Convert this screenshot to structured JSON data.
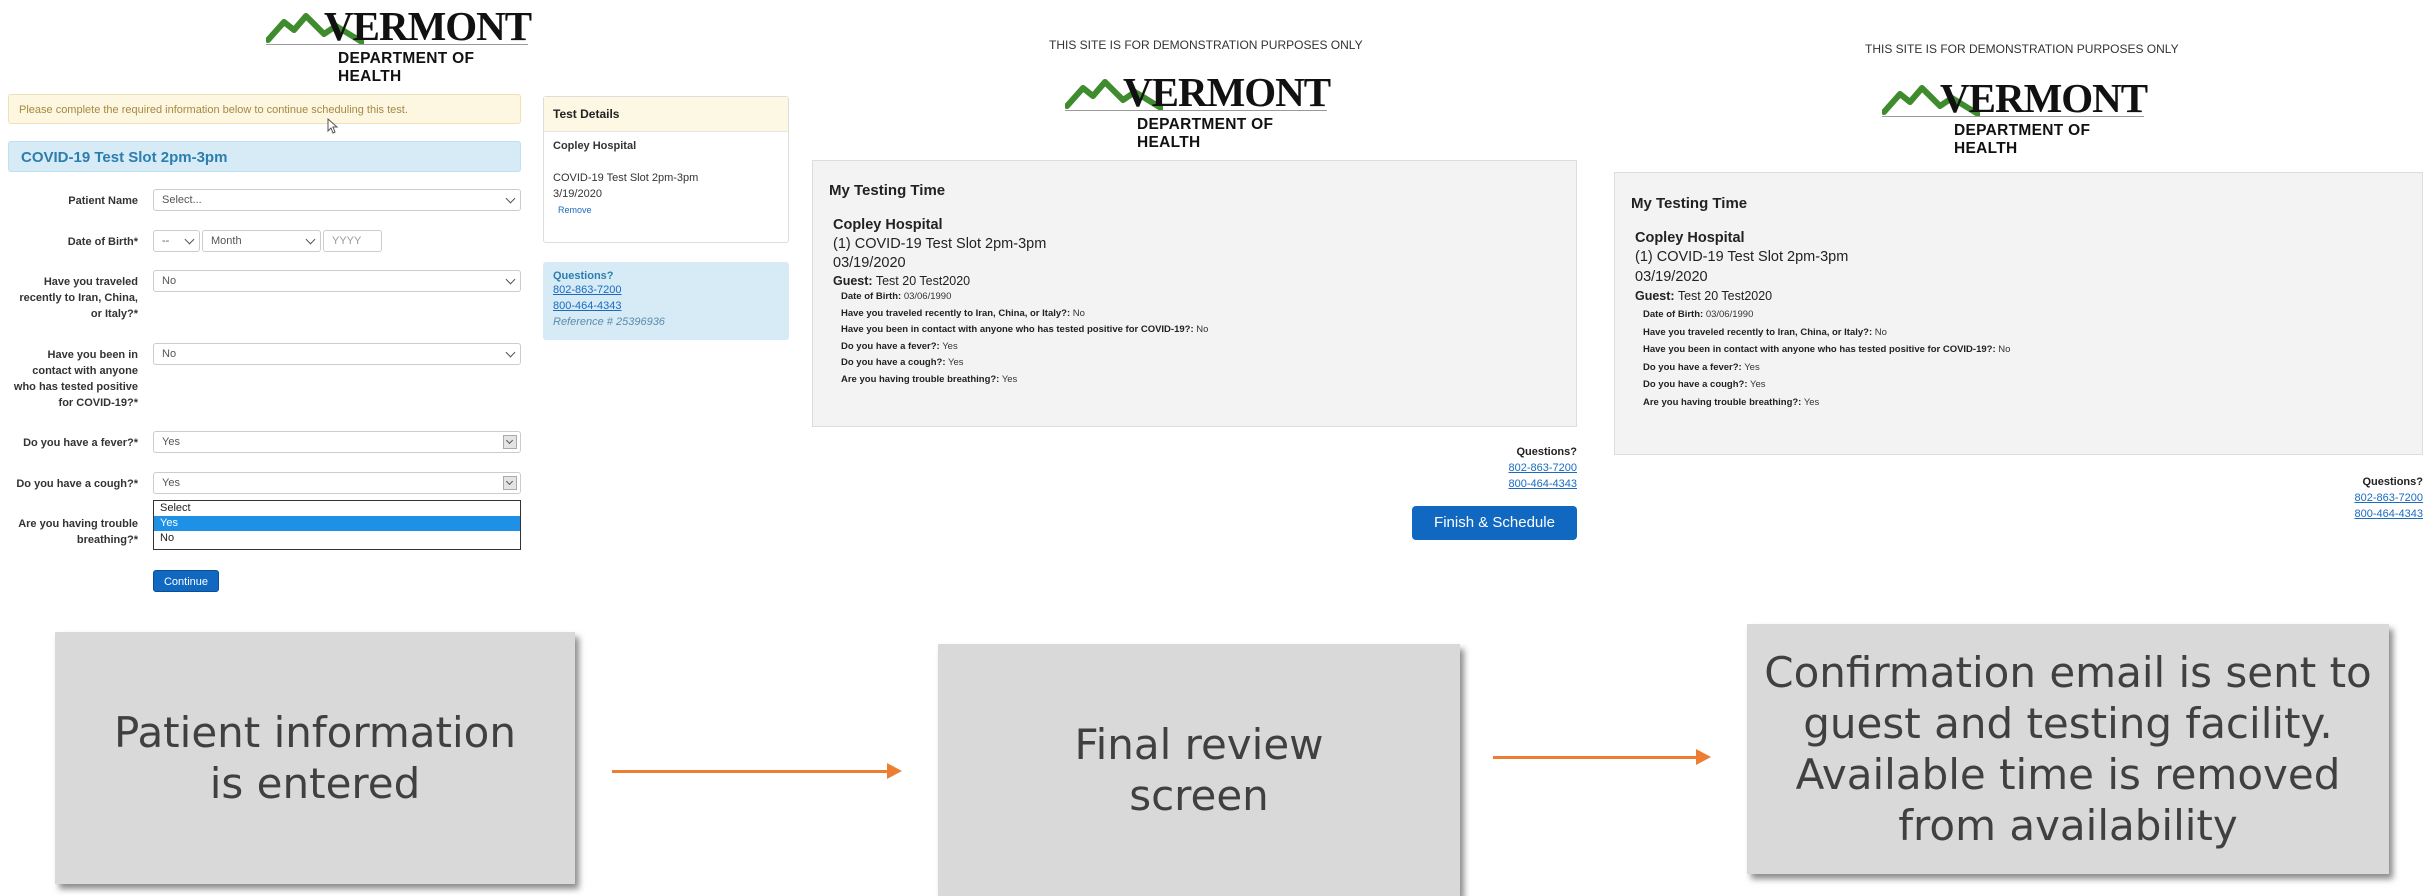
{
  "logo": {
    "state": "VERMONT",
    "dept": "DEPARTMENT OF HEALTH"
  },
  "demo_notice": "THIS SITE IS FOR DEMONSTRATION PURPOSES ONLY",
  "form": {
    "alert": "Please complete the required information below to continue scheduling this test.",
    "slot_title": "COVID-19 Test Slot 2pm-3pm",
    "patient_name_label": "Patient Name",
    "patient_name_value": "Select...",
    "dob_label": "Date of Birth*",
    "dob_day": "--",
    "dob_month": "Month",
    "dob_year_placeholder": "YYYY",
    "travel_label": "Have you traveled recently to Iran, China, or Italy?*",
    "travel_value": "No",
    "contact_label": "Have you been in contact with anyone who has tested positive for COVID-19?*",
    "contact_value": "No",
    "fever_label": "Do you have a fever?*",
    "fever_value": "Yes",
    "cough_label": "Do you have a cough?*",
    "cough_value": "Yes",
    "breathing_label": "Are you having trouble breathing?*",
    "dropdown_options": [
      "Select",
      "Yes",
      "No"
    ],
    "continue_label": "Continue"
  },
  "test_details": {
    "header": "Test Details",
    "facility": "Copley Hospital",
    "slot": "COVID-19 Test Slot 2pm-3pm",
    "date": "3/19/2020",
    "remove": "Remove"
  },
  "questions_box": {
    "title": "Questions?",
    "phone1": "802-863-7200",
    "phone2": "800-464-4343",
    "reference": "Reference # 25396936"
  },
  "review": {
    "title": "My Testing Time",
    "facility": "Copley Hospital",
    "slot": "(1) COVID-19 Test Slot 2pm-3pm",
    "date": "03/19/2020",
    "guest_label": "Guest:",
    "guest_name": "Test 20 Test2020",
    "q": [
      {
        "label": "Date of Birth:",
        "value": "03/06/1990"
      },
      {
        "label": "Have you traveled recently to Iran, China, or Italy?:",
        "value": "No"
      },
      {
        "label": "Have you been in contact with anyone who has tested positive for COVID-19?:",
        "value": "No"
      },
      {
        "label": "Do you have a fever?:",
        "value": "Yes"
      },
      {
        "label": "Do you have a cough?:",
        "value": "Yes"
      },
      {
        "label": "Are you having trouble breathing?:",
        "value": "Yes"
      }
    ],
    "questions_title": "Questions?",
    "phone1": "802-863-7200",
    "phone2": "800-464-4343",
    "finish_label": "Finish & Schedule"
  },
  "captions": {
    "step1": "Patient information is entered",
    "step2": "Final review screen",
    "step3": "Confirmation email is sent to guest and testing facility. Available time is removed from availability"
  },
  "colors": {
    "accent_blue": "#1068c1",
    "arrow_orange": "#ed7d31",
    "caption_bg": "#d9d9d9"
  }
}
